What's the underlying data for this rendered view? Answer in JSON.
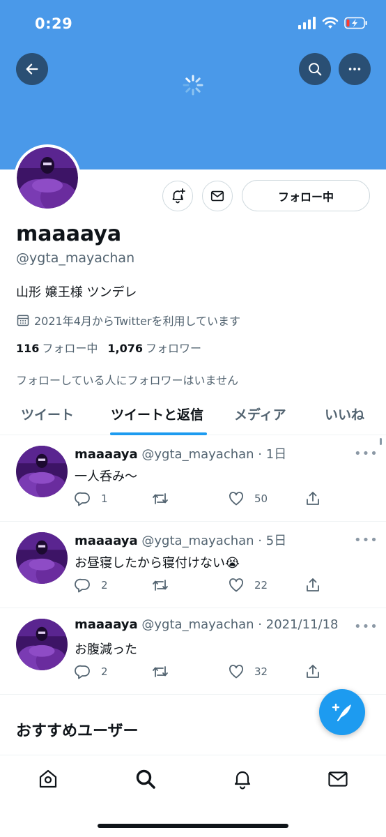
{
  "status_bar": {
    "time": "0:29"
  },
  "profile": {
    "display_name": "maaaaya",
    "handle": "@ygta_mayachan",
    "bio": "山形 嬢王様 ツンデレ",
    "joined": "2021年4月からTwitterを利用しています",
    "following_count": "116",
    "following_label": "フォロー中",
    "followers_count": "1,076",
    "followers_label": "フォロワー",
    "no_mutual_followers": "フォローしている人にフォロワーはいません",
    "follow_button": "フォロー中"
  },
  "tabs": [
    {
      "label": "ツイート",
      "active": false
    },
    {
      "label": "ツイートと返信",
      "active": true
    },
    {
      "label": "メディア",
      "active": false
    },
    {
      "label": "いいね",
      "active": false
    }
  ],
  "tweets": [
    {
      "name": "maaaaya",
      "handle": "@ygta_mayachan",
      "date": "· 1日",
      "text": "一人呑み〜",
      "replies": "1",
      "retweets": "",
      "likes": "50"
    },
    {
      "name": "maaaaya",
      "handle": "@ygta_mayachan",
      "date": "· 5日",
      "text": "お昼寝したから寝付けない😭",
      "replies": "2",
      "retweets": "",
      "likes": "22"
    },
    {
      "name": "maaaaya",
      "handle": "@ygta_mayachan",
      "date": "· 2021/11/18",
      "text": "お腹減った",
      "replies": "2",
      "retweets": "",
      "likes": "32"
    }
  ],
  "recommended": {
    "title": "おすすめユーザー"
  },
  "colors": {
    "banner": "#4a99e9",
    "accent": "#1d9bf0",
    "avatar_purple": "#6a2c9e"
  },
  "icons": {
    "back": "arrow-left-icon",
    "search": "search-icon",
    "more": "more-horizontal-icon",
    "notify": "bell-plus-icon",
    "message": "envelope-icon",
    "calendar": "calendar-icon",
    "compose": "feather-plus-icon",
    "nav": [
      "home-icon",
      "search-icon",
      "bell-icon",
      "envelope-icon"
    ]
  }
}
